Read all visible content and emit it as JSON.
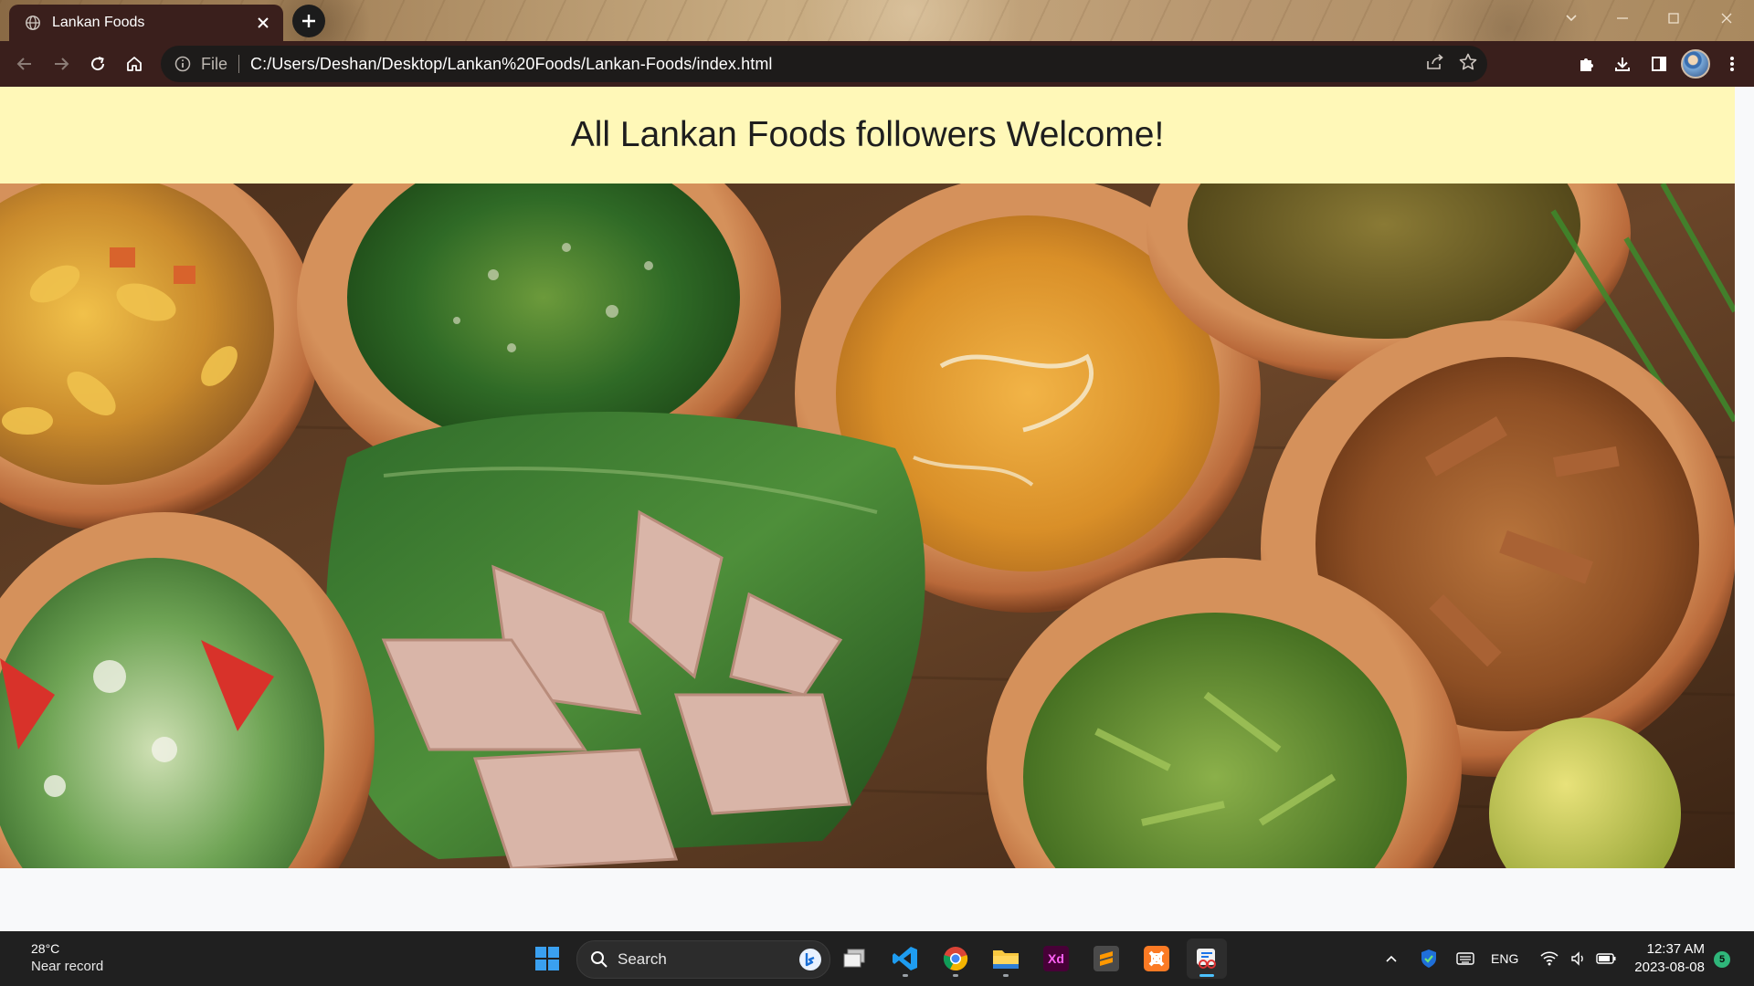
{
  "browser": {
    "tab_title": "Lankan Foods",
    "address_scheme_label": "File",
    "address_url": "C:/Users/Deshan/Desktop/Lankan%20Foods/Lankan-Foods/index.html"
  },
  "page": {
    "welcome_heading": "All Lankan Foods followers Welcome!",
    "welcome_bar_color": "#fff8b8"
  },
  "taskbar": {
    "weather_temp": "28°C",
    "weather_condition": "Near record",
    "search_label": "Search",
    "language": "ENG",
    "time": "12:37 AM",
    "date": "2023-08-08",
    "notification_count": "5"
  }
}
